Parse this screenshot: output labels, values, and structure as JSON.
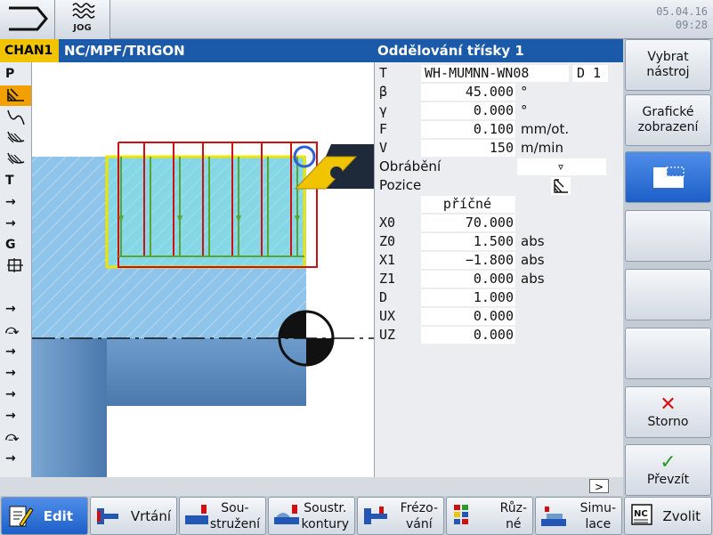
{
  "header": {
    "mode": "JOG",
    "date": "05.04.16",
    "time": "09:28"
  },
  "channel": {
    "name": "CHAN1",
    "program_path": "NC/MPF/TRIGON",
    "cycle_title": "Oddělování třísky 1"
  },
  "left_strip": {
    "items": [
      "P",
      "T",
      "G"
    ]
  },
  "form": {
    "fields": [
      {
        "label": "T",
        "value": "WH-MUMNN-WN08",
        "extra": "D 1"
      },
      {
        "label": "β",
        "value": "45.000",
        "unit": "°"
      },
      {
        "label": "γ",
        "value": "0.000",
        "unit": "°"
      },
      {
        "label": "F",
        "value": "0.100",
        "unit": "mm/ot."
      },
      {
        "label": "V",
        "value": "150",
        "unit": "m/min"
      }
    ],
    "machining_label": "Obrábění",
    "machining_value": "▿",
    "position_label": "Pozice",
    "direction_value": "příčné",
    "coords": [
      {
        "label": "X0",
        "value": "70.000",
        "unit": ""
      },
      {
        "label": "Z0",
        "value": "1.500",
        "unit": "abs"
      },
      {
        "label": "X1",
        "value": "−1.800",
        "unit": "abs"
      },
      {
        "label": "Z1",
        "value": "0.000",
        "unit": "abs"
      },
      {
        "label": "D",
        "value": "1.000",
        "unit": ""
      },
      {
        "label": "UX",
        "value": "0.000",
        "unit": ""
      },
      {
        "label": "UZ",
        "value": "0.000",
        "unit": ""
      }
    ]
  },
  "vertical_softkeys": {
    "select_tool": "Vybrat nástroj",
    "graphic_view": "Grafické zobrazení",
    "cancel": "Storno",
    "accept": "Převzít"
  },
  "horizontal_softkeys": {
    "edit": "Edit",
    "drilling": "Vrtání",
    "turning_1": "Sou-",
    "turning_2": "stružení",
    "contour_1": "Soustr.",
    "contour_2": "kontury",
    "milling_1": "Frézo-",
    "milling_2": "vání",
    "misc_1": "Růz-",
    "misc_2": "né",
    "sim_1": "Simu-",
    "sim_2": "lace",
    "select": "Zvolit"
  },
  "more_button": ">",
  "colors": {
    "channel_yellow": "#f2c400",
    "header_blue": "#1a5aa8",
    "active_softkey": "#1d5fc9",
    "workpiece_blue": "#8ec4ea",
    "path_red": "#d01010",
    "path_green": "#5aa530",
    "blank_yellow": "#f0e400"
  }
}
